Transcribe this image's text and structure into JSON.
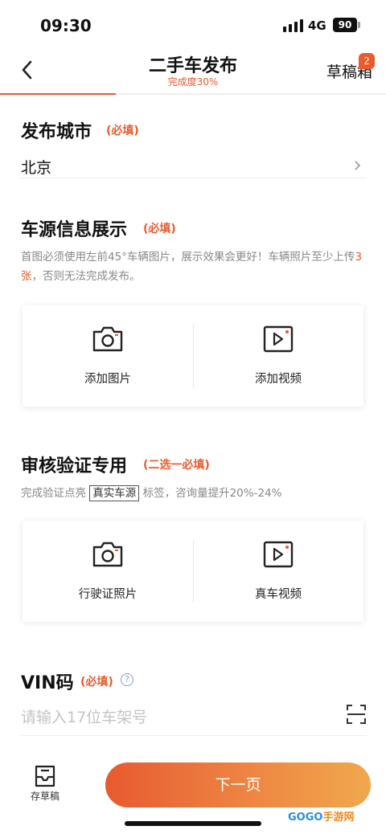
{
  "status": {
    "time": "09:30",
    "network": "4G",
    "battery": "90"
  },
  "nav": {
    "title": "二手车发布",
    "progress_text": "完成度30%",
    "progress_fraction": 0.3,
    "drafts_label": "草稿箱",
    "drafts_count": "2"
  },
  "city": {
    "title": "发布城市",
    "required": "(必填)",
    "value": "北京"
  },
  "vehicle_info": {
    "title": "车源信息展示",
    "required": "(必填)",
    "desc_part1": "首图必须使用左前45°车辆图片，展示效果会更好！车辆照片至少上传",
    "desc_highlight": "3张",
    "desc_part2": "，否则无法完成发布。",
    "add_photo": "添加图片",
    "add_video": "添加视频"
  },
  "verification": {
    "title": "审核验证专用",
    "required": "(二选一必填)",
    "desc_part1": "完成验证点亮",
    "tag": "真实车源",
    "desc_part2": "标签，咨询量提升20%-24%",
    "license_photo": "行驶证照片",
    "real_video": "真车视频"
  },
  "vin": {
    "title": "VIN码",
    "required": "(必填)",
    "help": "?",
    "placeholder": "请输入17位车架号"
  },
  "bottom": {
    "save_draft": "存草稿",
    "next": "下一页"
  },
  "watermark": {
    "left": "GOGO",
    "right": "手游网"
  },
  "colors": {
    "accent": "#ea5a2c"
  },
  "icons": [
    "back-icon",
    "chevron-right-icon",
    "camera-icon",
    "video-icon",
    "help-icon",
    "scan-icon",
    "inbox-icon"
  ]
}
